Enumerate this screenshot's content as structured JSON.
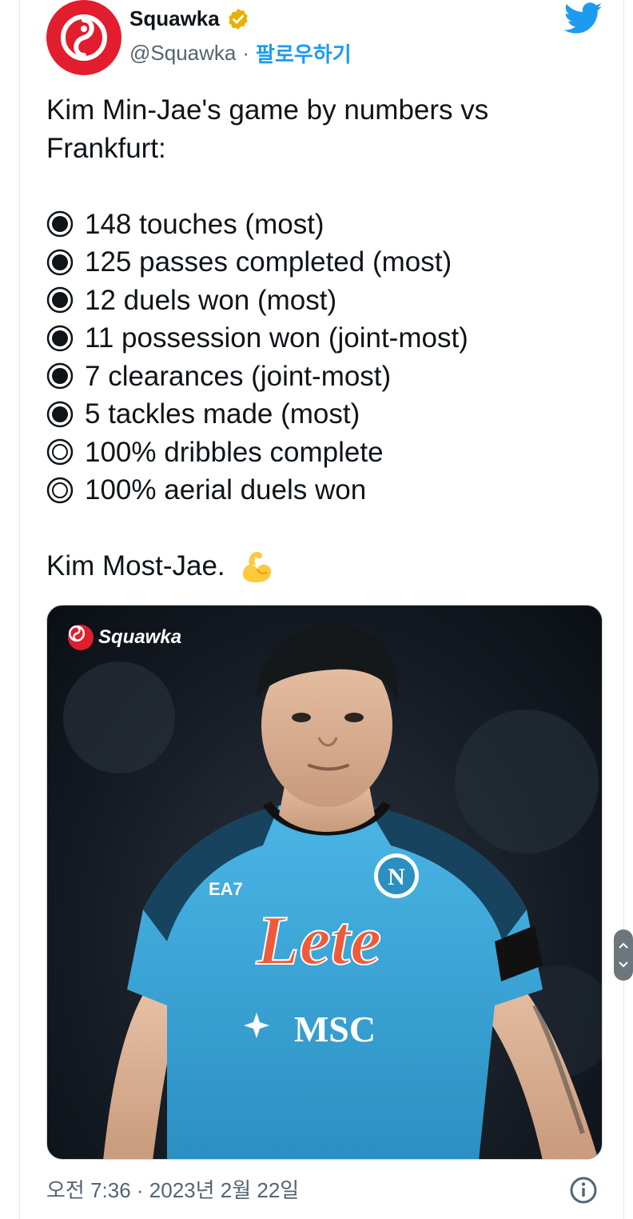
{
  "author": {
    "display_name": "Squawka",
    "handle": "@Squawka",
    "separator": "·",
    "follow_label": "팔로우하기",
    "avatar_color": "#e11d2e",
    "verified_color": "#e8b100"
  },
  "tweet": {
    "intro_line1": "Kim Min-Jae's game by numbers vs",
    "intro_line2": "Frankfurt:",
    "stats": [
      {
        "bullet": "filled",
        "text": "148 touches (most)"
      },
      {
        "bullet": "filled",
        "text": "125 passes completed (most)"
      },
      {
        "bullet": "filled",
        "text": "12 duels won (most)"
      },
      {
        "bullet": "filled",
        "text": "11 possession won (joint-most)"
      },
      {
        "bullet": "filled",
        "text": "7 clearances (joint-most)"
      },
      {
        "bullet": "filled",
        "text": "5 tackles made (most)"
      },
      {
        "bullet": "hollow",
        "text": "100% dribbles complete"
      },
      {
        "bullet": "hollow",
        "text": "100% aerial duels won"
      }
    ],
    "closing": "Kim Most-Jae.",
    "closing_emoji": "flexed-biceps-icon"
  },
  "media": {
    "brand_label": "Squawka",
    "shirt_sponsor": "Lete",
    "shirt_secondary_sponsor": "MSC",
    "kit_brand": "EA7",
    "crest_letter": "N"
  },
  "footer": {
    "timestamp": "오전 7:36 · 2023년 2월 22일"
  },
  "colors": {
    "link_blue": "#1d9bf0",
    "muted_text": "#536471",
    "kit_blue": "#3aa6d8"
  }
}
